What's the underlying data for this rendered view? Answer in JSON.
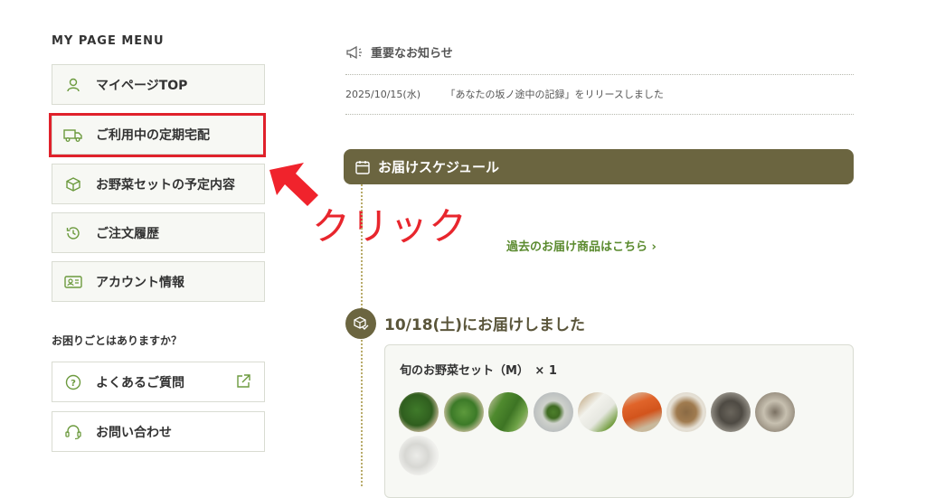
{
  "sidebar": {
    "heading": "MY PAGE MENU",
    "items": [
      {
        "label": "マイページTOP",
        "icon": "person-icon"
      },
      {
        "label": "ご利用中の定期宅配",
        "icon": "truck-icon"
      },
      {
        "label": "お野菜セットの予定内容",
        "icon": "box-icon"
      },
      {
        "label": "ご注文履歴",
        "icon": "history-icon"
      },
      {
        "label": "アカウント情報",
        "icon": "id-card-icon"
      }
    ],
    "help_heading": "お困りごとはありますか？",
    "help_items": [
      {
        "label": "よくあるご質問",
        "icon": "question-icon"
      },
      {
        "label": "お問い合わせ",
        "icon": "headset-icon"
      }
    ]
  },
  "annotation": {
    "click_text": "クリック",
    "color": "#e8262d"
  },
  "notice": {
    "heading": "重要なお知らせ",
    "date": "2025/10/15(水)",
    "text": "「あなたの坂ノ途中の記録」をリリースしました"
  },
  "schedule": {
    "heading": "お届けスケジュール",
    "past_link": "過去のお届け商品はこちら ›",
    "delivered_title": "10/18(土)にお届けしました",
    "product": "旬のお野菜セット（M）　× 1",
    "vegetables": [
      "green-peppers",
      "greens",
      "okra",
      "sliced-vegetable",
      "daikon",
      "carrots",
      "mushrooms",
      "taro",
      "garlic",
      "white-vegetable"
    ]
  },
  "colors": {
    "brand": "#6b6540",
    "accent_green": "#5a8a2e",
    "highlight": "#e0212b"
  }
}
